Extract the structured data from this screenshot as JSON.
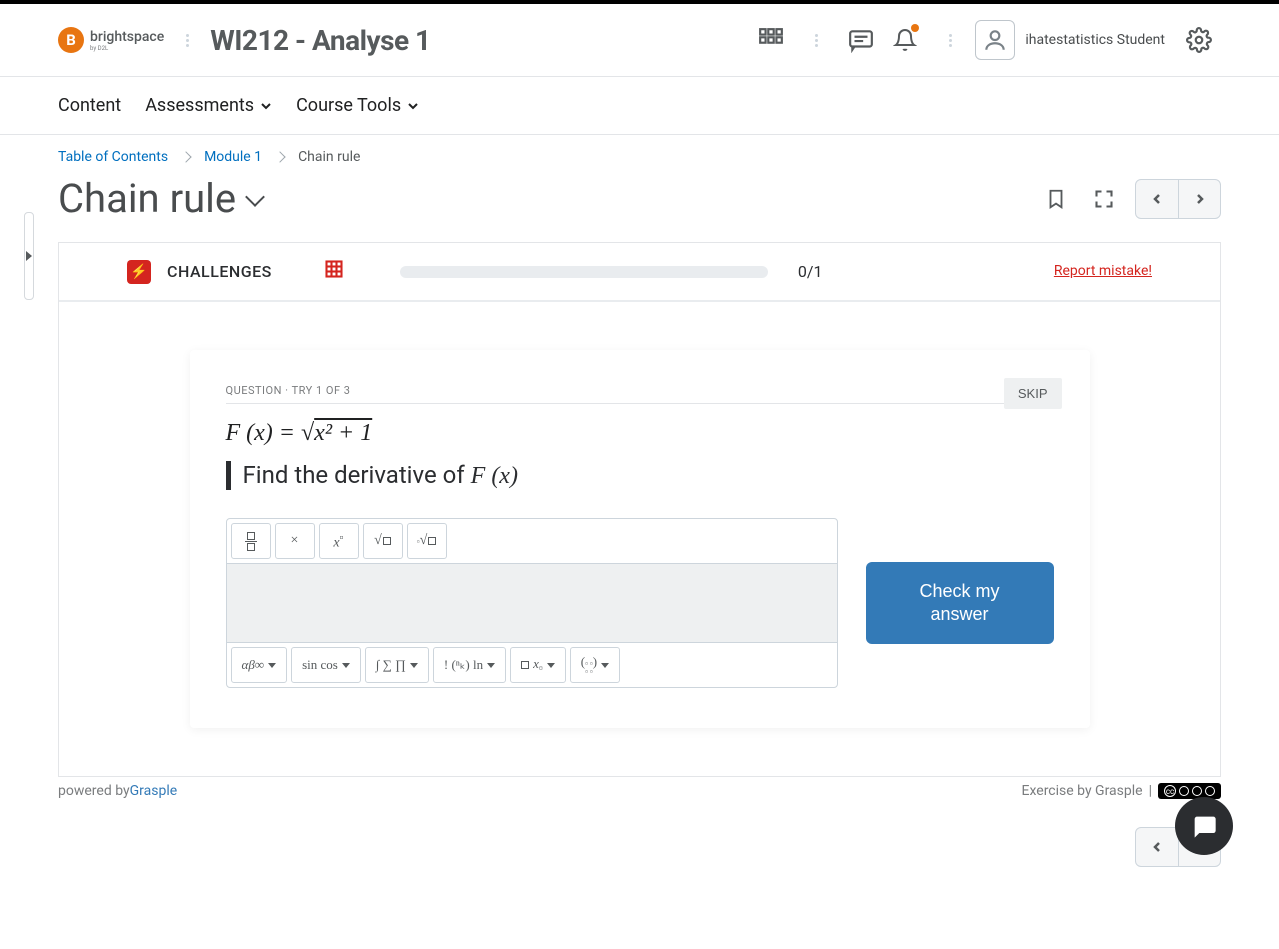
{
  "brand": {
    "logo_letter": "B",
    "logo_text": "brightspace",
    "logo_sub": "by D2L"
  },
  "course": {
    "title": "WI212 - Analyse 1"
  },
  "user": {
    "name": "ihatestatistics Student"
  },
  "nav": {
    "content": "Content",
    "assessments": "Assessments",
    "course_tools": "Course Tools"
  },
  "breadcrumb": {
    "toc": "Table of Contents",
    "module": "Module 1",
    "current": "Chain rule"
  },
  "page": {
    "title": "Chain rule"
  },
  "challenge": {
    "label": "CHALLENGES",
    "progress_text": "0/1",
    "report": "Report mistake!"
  },
  "question": {
    "meta": "QUESTION · TRY 1 OF 3",
    "skip": "SKIP",
    "formula_lhs": "F (x) = ",
    "formula_sqrt": "x² + 1",
    "instruction_pre": "Find the derivative of ",
    "instruction_fx": "F (x)",
    "check": "Check my answer"
  },
  "editor_top": {
    "frac": "▯/▯",
    "times": "×",
    "power": "x▫",
    "sqrt": "√▯",
    "nroot": "ⁿ√▯"
  },
  "editor_bottom": {
    "greek": "αβ∞",
    "trig": "sin cos",
    "calc": "∫ ∑ ∏",
    "comb": "! (ⁿₖ) ln",
    "sub": "▯ x▫",
    "matrix": "( ▫ ▫ ▫ ▫ )"
  },
  "footer": {
    "powered_pre": "powered by ",
    "powered_link": "Grasple",
    "exercise_by": "Exercise by Grasple",
    "cc": "CC ◉◉◉"
  }
}
